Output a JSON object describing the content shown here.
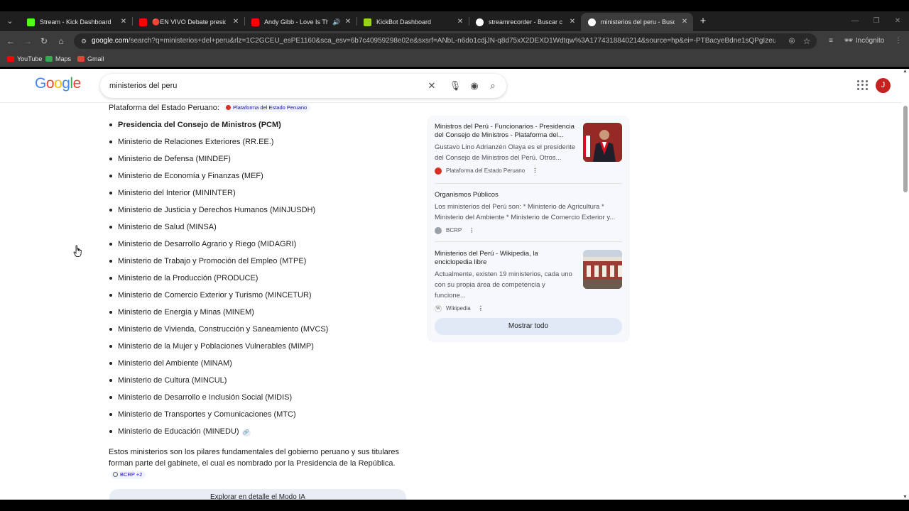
{
  "tabs": [
    {
      "label": "Stream - Kick Dashboard",
      "favicon_color": "#53fc18",
      "active": false
    },
    {
      "label": "🔴EN VIVO Debate presidencial",
      "favicon_color": "#ff0000",
      "active": false
    },
    {
      "label": "Andy Gibb - Love Is Thicker",
      "favicon_color": "#ff0000",
      "active": false
    },
    {
      "label": "KickBot Dashboard",
      "favicon_color": "#9ad21a",
      "active": false
    },
    {
      "label": "streamrecorder - Buscar con Google",
      "favicon_color": "#ffffff",
      "active": false
    },
    {
      "label": "ministerios del peru - Buscar con Google",
      "favicon_color": "#ffffff",
      "active": true
    }
  ],
  "address_bar": {
    "host": "google.com",
    "path": "/search?q=ministerios+del+peru&rlz=1C2GCEU_esPE1160&sca_esv=6b7c40959298e02e&sxsrf=ANbL-n6do1cdjJN-q8d75xX2DEXD1Wdtqw%3A1774318840214&source=hp&ei=-PTBacyeBdne1sQPgIzeuAE&iflsig=AFdpzrg..."
  },
  "profile_label": "Incógnito",
  "bookmarks": [
    {
      "label": "YouTube",
      "icon_color": "#ff0000"
    },
    {
      "label": "Maps",
      "icon_color": "#34a853"
    },
    {
      "label": "Gmail",
      "icon_color": "#ea4335"
    }
  ],
  "google": {
    "logo_letters": [
      {
        "ch": "G",
        "color": "#4285f4"
      },
      {
        "ch": "o",
        "color": "#ea4335"
      },
      {
        "ch": "o",
        "color": "#fbbc05"
      },
      {
        "ch": "g",
        "color": "#4285f4"
      },
      {
        "ch": "l",
        "color": "#34a853"
      },
      {
        "ch": "e",
        "color": "#ea4335"
      }
    ],
    "query": "ministerios del peru",
    "avatar_letter": "J"
  },
  "answer": {
    "intro": "Plataforma del Estado Peruano:",
    "intro_chip": "Plataforma del Estado Peruano",
    "ministries": [
      "Presidencia del Consejo de Ministros (PCM)",
      "Ministerio de Relaciones Exteriores (RR.EE.)",
      "Ministerio de Defensa (MINDEF)",
      "Ministerio de Economía y Finanzas (MEF)",
      "Ministerio del Interior (MININTER)",
      "Ministerio de Justicia y Derechos Humanos (MINJUSDH)",
      "Ministerio de Salud (MINSA)",
      "Ministerio de Desarrollo Agrario y Riego (MIDAGRI)",
      "Ministerio de Trabajo y Promoción del Empleo (MTPE)",
      "Ministerio de la Producción (PRODUCE)",
      "Ministerio de Comercio Exterior y Turismo (MINCETUR)",
      "Ministerio de Energía y Minas (MINEM)",
      "Ministerio de Vivienda, Construcción y Saneamiento (MVCS)",
      "Ministerio de la Mujer y Poblaciones Vulnerables (MIMP)",
      "Ministerio del Ambiente (MINAM)",
      "Ministerio de Cultura (MINCUL)",
      "Ministerio de Desarrollo e Inclusión Social (MIDIS)",
      "Ministerio de Transportes y Comunicaciones (MTC)",
      "Ministerio de Educación (MINEDU)"
    ],
    "summary": "Estos ministerios son los pilares fundamentales del gobierno peruano y sus titulares forman parte del gabinete, el cual es nombrado por la Presidencia de la República.",
    "summary_chip": "BCRP +2",
    "ai_mode_button": "Explorar en detalle el Modo IA"
  },
  "sources": [
    {
      "title": "Ministros del Perú - Funcionarios - Presidencia del Consejo de Ministros - Plataforma del...",
      "snippet": "Gustavo Lino Adrianzén Olaya es el presidente del Consejo de Ministros del Perú. Otros...",
      "site": "Plataforma del Estado Peruano",
      "site_icon_color": "#d93025"
    },
    {
      "title": "Organismos Públicos",
      "snippet": "Los ministerios del Perú son: * Ministerio de Agricultura * Ministerio del Ambiente * Ministerio de Comercio Exterior y...",
      "site": "BCRP",
      "site_icon_color": "#9aa0a6"
    },
    {
      "title": "Ministerios del Perú - Wikipedia, la enciclopedia libre",
      "snippet": "Actualmente, existen 19 ministerios, cada uno con su propia área de competencia y funcione...",
      "site": "Wikipedia",
      "site_icon_color": "#ffffff"
    }
  ],
  "show_all_label": "Mostrar todo"
}
